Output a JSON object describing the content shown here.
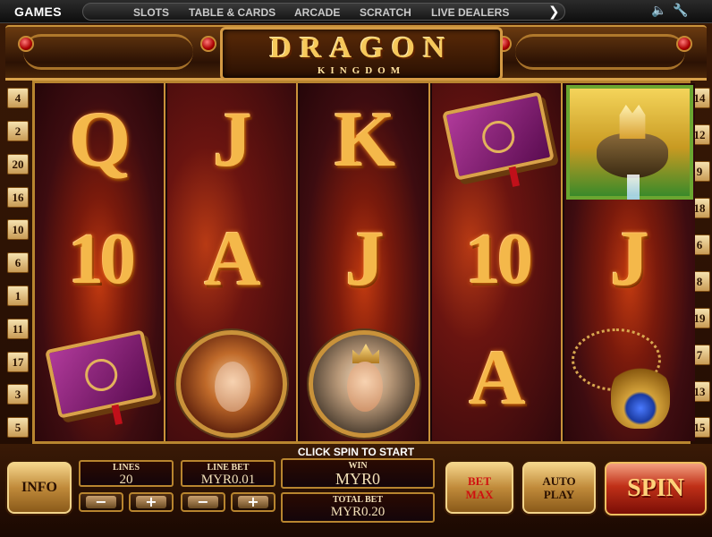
{
  "nav": {
    "brand": "GAMES",
    "items": [
      "SLOTS",
      "TABLE & CARDS",
      "ARCADE",
      "SCRATCH",
      "LIVE DEALERS"
    ],
    "next_glyph": "❯",
    "sound_icon": "🔈",
    "settings_icon": "🔧"
  },
  "game": {
    "title": "DRAGON",
    "subtitle": "KINGDOM"
  },
  "paylines": {
    "left": [
      "4",
      "2",
      "20",
      "16",
      "10",
      "6",
      "1",
      "11",
      "17",
      "3",
      "5"
    ],
    "right": [
      "14",
      "12",
      "9",
      "18",
      "6",
      "8",
      "19",
      "7",
      "13",
      "15"
    ]
  },
  "reels": [
    [
      {
        "type": "letter",
        "value": "Q"
      },
      {
        "type": "ten",
        "value": "10"
      },
      {
        "type": "book",
        "value": "Spell Book"
      }
    ],
    [
      {
        "type": "letter",
        "value": "J"
      },
      {
        "type": "letter",
        "value": "A"
      },
      {
        "type": "portrait-w",
        "value": "Warrior Princess"
      }
    ],
    [
      {
        "type": "letter",
        "value": "K"
      },
      {
        "type": "letter",
        "value": "J"
      },
      {
        "type": "portrait-m",
        "value": "King"
      }
    ],
    [
      {
        "type": "book",
        "value": "Spell Book"
      },
      {
        "type": "ten",
        "value": "10"
      },
      {
        "type": "letter",
        "value": "A"
      }
    ],
    [
      {
        "type": "castle",
        "value": "Floating Castle"
      },
      {
        "type": "letter",
        "value": "J"
      },
      {
        "type": "amulet",
        "value": "Dragon Amulet"
      }
    ]
  ],
  "controls": {
    "status": "CLICK SPIN TO START",
    "info_label": "INFO",
    "lines_label": "LINES",
    "lines_value": "20",
    "line_bet_label": "LINE BET",
    "line_bet_value": "MYR0.01",
    "win_label": "WIN",
    "win_value": "MYR0",
    "total_bet_label": "TOTAL BET",
    "total_bet_value": "MYR0.20",
    "minus": "−",
    "plus": "+",
    "bet_max_label_1": "BET",
    "bet_max_label_2": "MAX",
    "auto_label_1": "AUTO",
    "auto_label_2": "PLAY",
    "spin_label": "SPIN"
  },
  "colors": {
    "gold": "#f4b84a",
    "frame": "#c9923a",
    "spin_red": "#c03018",
    "betmax_text": "#d01010"
  }
}
